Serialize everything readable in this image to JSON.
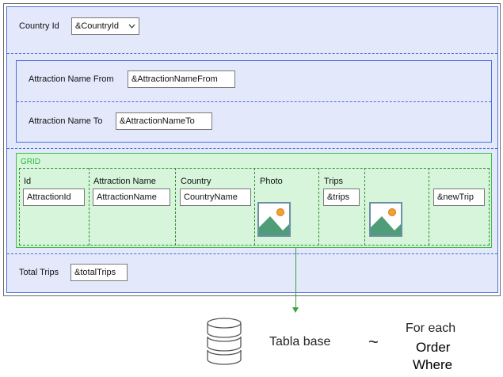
{
  "country": {
    "label": "Country Id",
    "value": "&CountryId"
  },
  "filters": {
    "from": {
      "label": "Attraction Name From",
      "value": "&AttractionNameFrom"
    },
    "to": {
      "label": "Attraction Name To",
      "value": "&AttractionNameTo"
    }
  },
  "grid": {
    "title": "GRID",
    "columns": [
      {
        "header": "Id",
        "value": "AttractionId"
      },
      {
        "header": "Attraction Name",
        "value": "AttractionName"
      },
      {
        "header": "Country",
        "value": "CountryName"
      },
      {
        "header": "Photo",
        "value": "",
        "icon": "image-icon"
      },
      {
        "header": "Trips",
        "value": "&trips"
      },
      {
        "header": "",
        "value": "",
        "icon": "image-icon"
      },
      {
        "header": "",
        "value": "&newTrip"
      }
    ]
  },
  "total": {
    "label": "Total Trips",
    "value": "&totalTrips"
  },
  "annotation": {
    "db_icon": "database-icon",
    "base_table": "Tabla base",
    "tilde": "~",
    "for_each": "For each",
    "order": "Order",
    "where": "Where"
  },
  "colors": {
    "canvas": "#e3e8fb",
    "border_blue": "#4a6fd8",
    "grid_bg": "#d6f5da",
    "grid_green": "#2db83d",
    "arrow_green": "#3aa43a"
  }
}
